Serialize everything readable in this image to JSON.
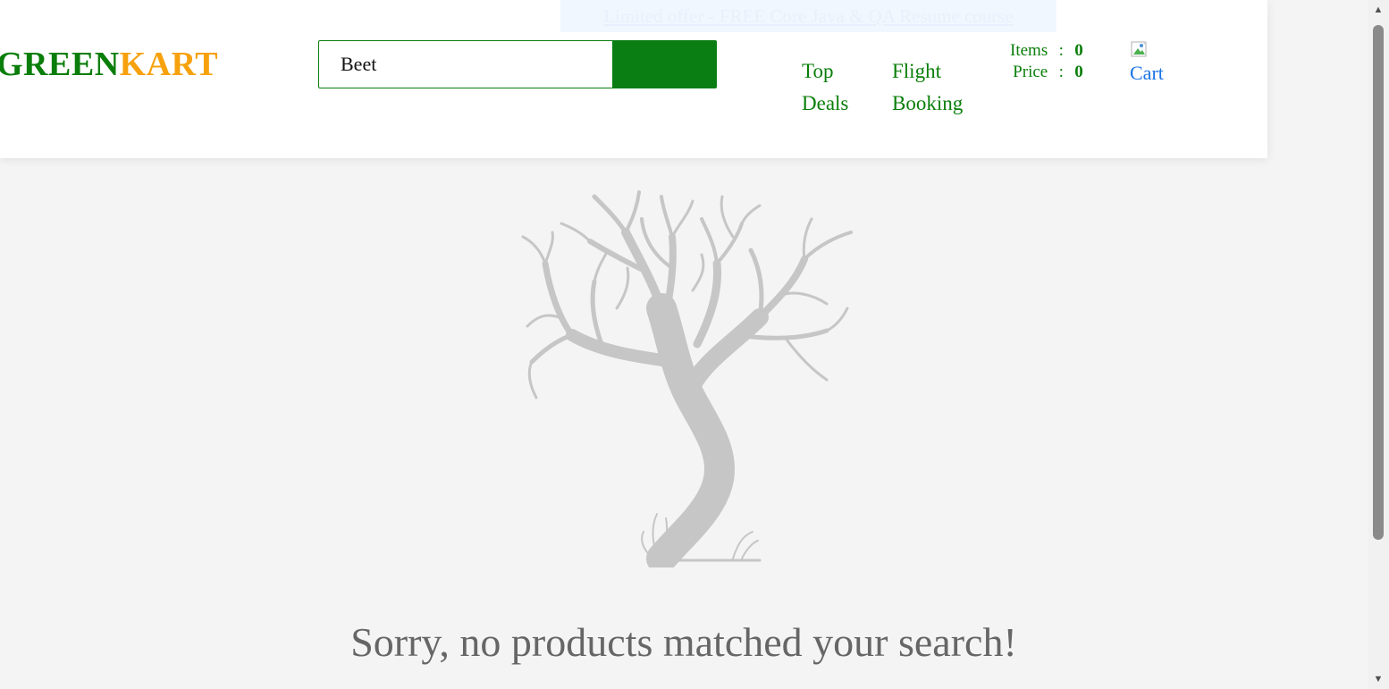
{
  "promo": {
    "text": "Limited offer - FREE Core Java & QA Resume course"
  },
  "logo": {
    "part1": "GREEN",
    "part2": "KART"
  },
  "search": {
    "value": "Beet"
  },
  "nav": {
    "top_deals": "Top Deals",
    "flight_booking": "Flight Booking"
  },
  "cart_summary": {
    "items_label": "Items",
    "items_value": "0",
    "price_label": "Price",
    "price_value": "0",
    "separator": ":"
  },
  "cart": {
    "label": "Cart"
  },
  "empty_state": {
    "message": "Sorry, no products matched your search!",
    "illustration": "bare-tree"
  },
  "colors": {
    "brand_green": "#0a7e0a",
    "brand_orange": "#f7a10d",
    "link_blue": "#1a73e8",
    "muted_text": "#666666",
    "tree_gray": "#c6c6c6"
  }
}
